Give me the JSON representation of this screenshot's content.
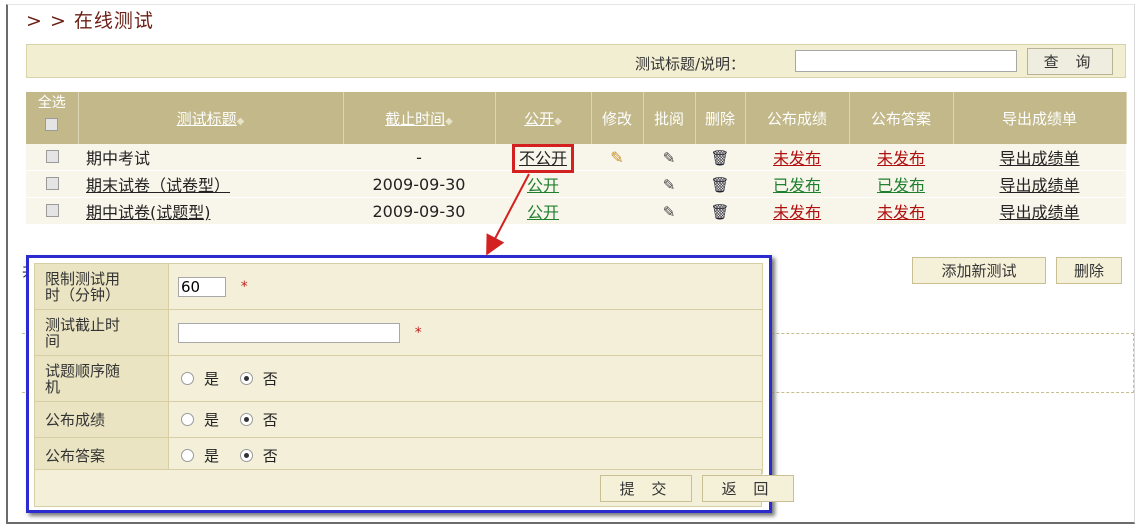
{
  "page": {
    "title": "> > 在线测试"
  },
  "search": {
    "label": "测试标题/说明：",
    "value": "",
    "button": "查 询"
  },
  "table": {
    "headers": {
      "select_all": "全选",
      "title": "测试标题",
      "deadline": "截止时间",
      "public": "公开",
      "edit": "修改",
      "grade": "批阅",
      "delete": "删除",
      "publish_scores": "公布成绩",
      "publish_answers": "公布答案",
      "export": "导出成绩单"
    },
    "rows": [
      {
        "title": "期中考试",
        "deadline": "-",
        "public": "不公开",
        "scores": "未发布",
        "answers": "未发布",
        "export": "导出成绩单"
      },
      {
        "title": "期末试卷（试卷型）",
        "deadline": "2009-09-30",
        "public": "公开",
        "scores": "已发布",
        "answers": "已发布",
        "export": "导出成绩单"
      },
      {
        "title": "期中试卷(试题型)",
        "deadline": "2009-09-30",
        "public": "公开",
        "scores": "未发布",
        "answers": "未发布",
        "export": "导出成绩单"
      }
    ]
  },
  "actions": {
    "add_test": "添加新测试",
    "delete": "删除"
  },
  "fragment": "共",
  "form": {
    "time_limit_label": "限制测试用时（分钟）",
    "time_limit_value": "60",
    "deadline_label": "测试截止时间",
    "deadline_value": "",
    "random_label": "试题顺序随机",
    "publish_scores_label": "公布成绩",
    "publish_answers_label": "公布答案",
    "yes": "是",
    "no": "否",
    "required_mark": "*",
    "submit": "提 交",
    "back": "返 回"
  },
  "icons": {
    "edit": "pencil-icon",
    "grade": "clipboard-icon",
    "delete": "trash-icon",
    "sort": "sort-arrows-icon"
  },
  "colors": {
    "header_bg": "#c2b88a",
    "highlight_red": "#d32020",
    "callout_blue": "#2b2bd0",
    "unpublished": "#b01010",
    "published": "#208030"
  }
}
